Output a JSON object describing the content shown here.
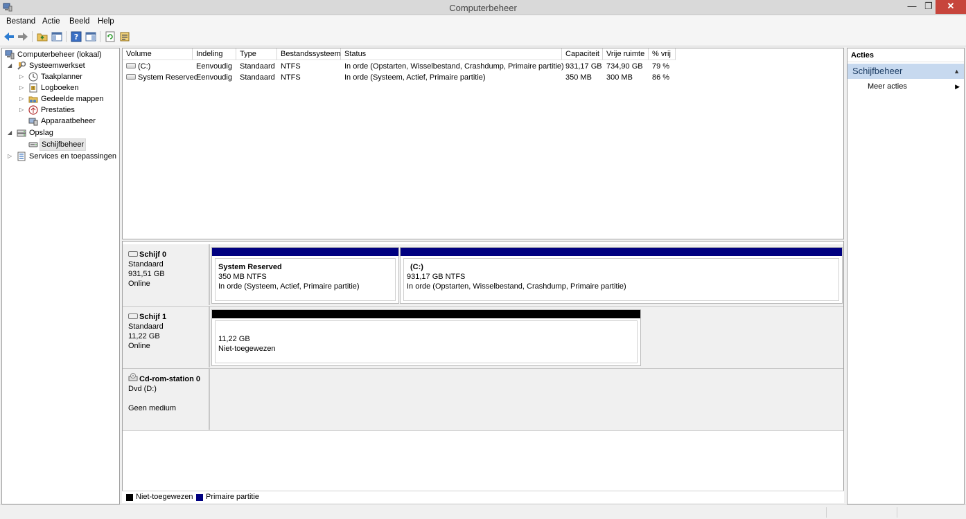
{
  "window": {
    "title": "Computerbeheer"
  },
  "menu": {
    "items": [
      "Bestand",
      "Actie",
      "Beeld",
      "Help"
    ]
  },
  "toolbar": {
    "buttons": [
      "back-icon",
      "forward-icon",
      "up-folder-icon",
      "show-hide-tree-icon",
      "help-icon",
      "show-hide-action-pane-icon",
      "refresh-icon",
      "properties-icon"
    ]
  },
  "tree": {
    "items": [
      {
        "label": "Computerbeheer (lokaal)",
        "icon": "computer-management-icon",
        "level": 0
      },
      {
        "label": "Systeemwerkset",
        "icon": "tools-icon",
        "level": 1,
        "expanded": true
      },
      {
        "label": "Taakplanner",
        "icon": "clock-icon",
        "level": 2
      },
      {
        "label": "Logboeken",
        "icon": "event-viewer-icon",
        "level": 2
      },
      {
        "label": "Gedeelde mappen",
        "icon": "shared-folders-icon",
        "level": 2
      },
      {
        "label": "Prestaties",
        "icon": "performance-icon",
        "level": 2
      },
      {
        "label": "Apparaatbeheer",
        "icon": "device-manager-icon",
        "level": 2
      },
      {
        "label": "Opslag",
        "icon": "storage-icon",
        "level": 1,
        "expanded": true
      },
      {
        "label": "Schijfbeheer",
        "icon": "disk-management-icon",
        "level": 2,
        "selected": true
      },
      {
        "label": "Services en toepassingen",
        "icon": "services-icon",
        "level": 1
      }
    ]
  },
  "volumes": {
    "columns": [
      "Volume",
      "Indeling",
      "Type",
      "Bestandssysteem",
      "Status",
      "Capaciteit",
      "Vrije ruimte",
      "% vrij"
    ],
    "rows": [
      [
        "(C:)",
        "Eenvoudig",
        "Standaard",
        "NTFS",
        "In orde (Opstarten, Wisselbestand, Crashdump, Primaire partitie)",
        "931,17 GB",
        "734,90 GB",
        "79 %"
      ],
      [
        "System Reserved",
        "Eenvoudig",
        "Standaard",
        "NTFS",
        "In orde (Systeem, Actief, Primaire partitie)",
        "350 MB",
        "300 MB",
        "86 %"
      ]
    ]
  },
  "disks": [
    {
      "name": "Schijf 0",
      "type": "Standaard",
      "size": "931,51 GB",
      "state": "Online",
      "partitions": [
        {
          "name": "System Reserved",
          "size": "350 MB NTFS",
          "status": "In orde (Systeem, Actief, Primaire partitie)"
        },
        {
          "name": "(C:)",
          "size": "931,17 GB NTFS",
          "status": "In orde (Opstarten, Wisselbestand, Crashdump, Primaire partitie)"
        }
      ]
    },
    {
      "name": "Schijf 1",
      "type": "Standaard",
      "size": "11,22 GB",
      "state": "Online",
      "partitions": [
        {
          "name": "",
          "size": "11,22 GB",
          "status": "Niet-toegewezen"
        }
      ]
    },
    {
      "name": "Cd-rom-station 0",
      "type": "Dvd (D:)",
      "size": "",
      "state": "Geen medium",
      "partitions": []
    }
  ],
  "legend": [
    {
      "label": "Niet-toegewezen",
      "color": "#000000"
    },
    {
      "label": "Primaire partitie",
      "color": "#000080"
    }
  ],
  "actions": {
    "header": "Acties",
    "section": "Schijfbeheer",
    "more": "Meer acties"
  },
  "colors": {
    "primary_partition": "#000080",
    "unallocated": "#000000",
    "actions_section_bg": "#c7d9ef"
  }
}
